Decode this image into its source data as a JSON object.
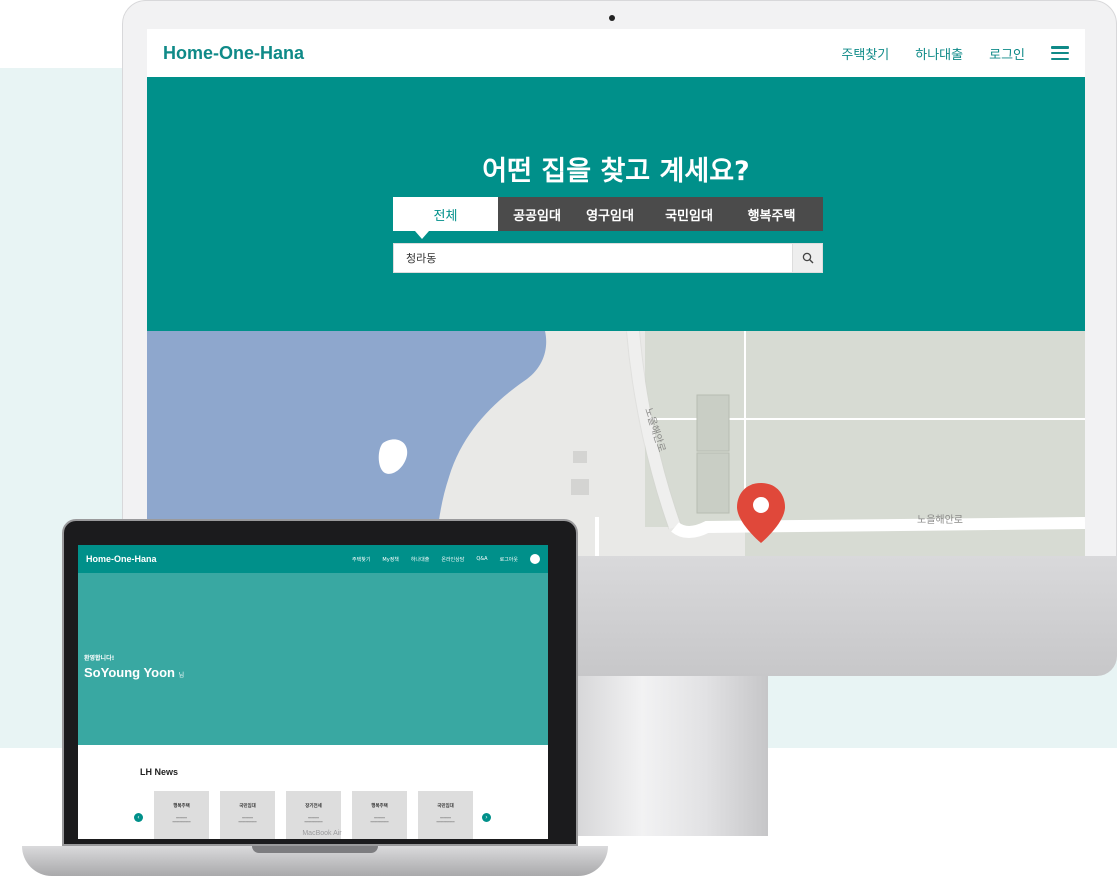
{
  "imac_site": {
    "logo": "Home-One-Hana",
    "nav": [
      "주택찾기",
      "하나대출",
      "로그인"
    ],
    "hero_title": "어떤 집을 찾고 계세요?",
    "tabs": [
      "전체",
      "공공임대",
      "영구임대",
      "국민임대",
      "행복주택"
    ],
    "search_value": "청라동",
    "map_road_labels": [
      "노을해안로",
      "노을해안로"
    ]
  },
  "macbook_site": {
    "logo": "Home-One-Hana",
    "nav": [
      "주택찾기",
      "My정책",
      "하나대출",
      "온라인상담",
      "Q&A",
      "로그아웃"
    ],
    "welcome": "환영합니다!",
    "user_name": "SoYoung Yoon",
    "name_suffix": "님",
    "news_title": "LH News",
    "news_cards": [
      "행복주택",
      "국민임대",
      "장기전세",
      "행복주택",
      "국민임대"
    ]
  },
  "device_label": "MacBook Air",
  "colors": {
    "brand_teal": "#00908a",
    "hero_light_teal": "#39a8a2",
    "tab_bar": "#4b4b4b",
    "marker_red": "#e0483a",
    "water": "#8ea7cd"
  }
}
